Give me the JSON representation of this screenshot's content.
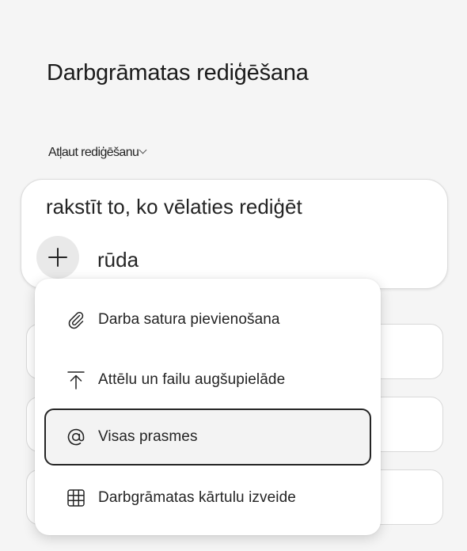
{
  "page": {
    "title": "Darbgrāmatas rediģēšana",
    "allow_label": "Atļaut rediģēšanu"
  },
  "composer": {
    "text": "rakstīt to, ko vēlaties rediģēt",
    "subtext": "rūda"
  },
  "menu": {
    "items": [
      {
        "label": "Darba satura pievienošana",
        "icon": "paperclip-icon"
      },
      {
        "label": "Attēlu un failu augšupielāde",
        "icon": "upload-icon"
      },
      {
        "label": "Visas prasmes",
        "icon": "at-icon",
        "selected": true
      },
      {
        "label": "Darbgrāmatas kārtulu izveide",
        "icon": "grid-icon"
      }
    ]
  },
  "colors": {
    "background": "#f5f5f5",
    "surface": "#ffffff",
    "text": "#242424",
    "selected_border": "#242424"
  }
}
